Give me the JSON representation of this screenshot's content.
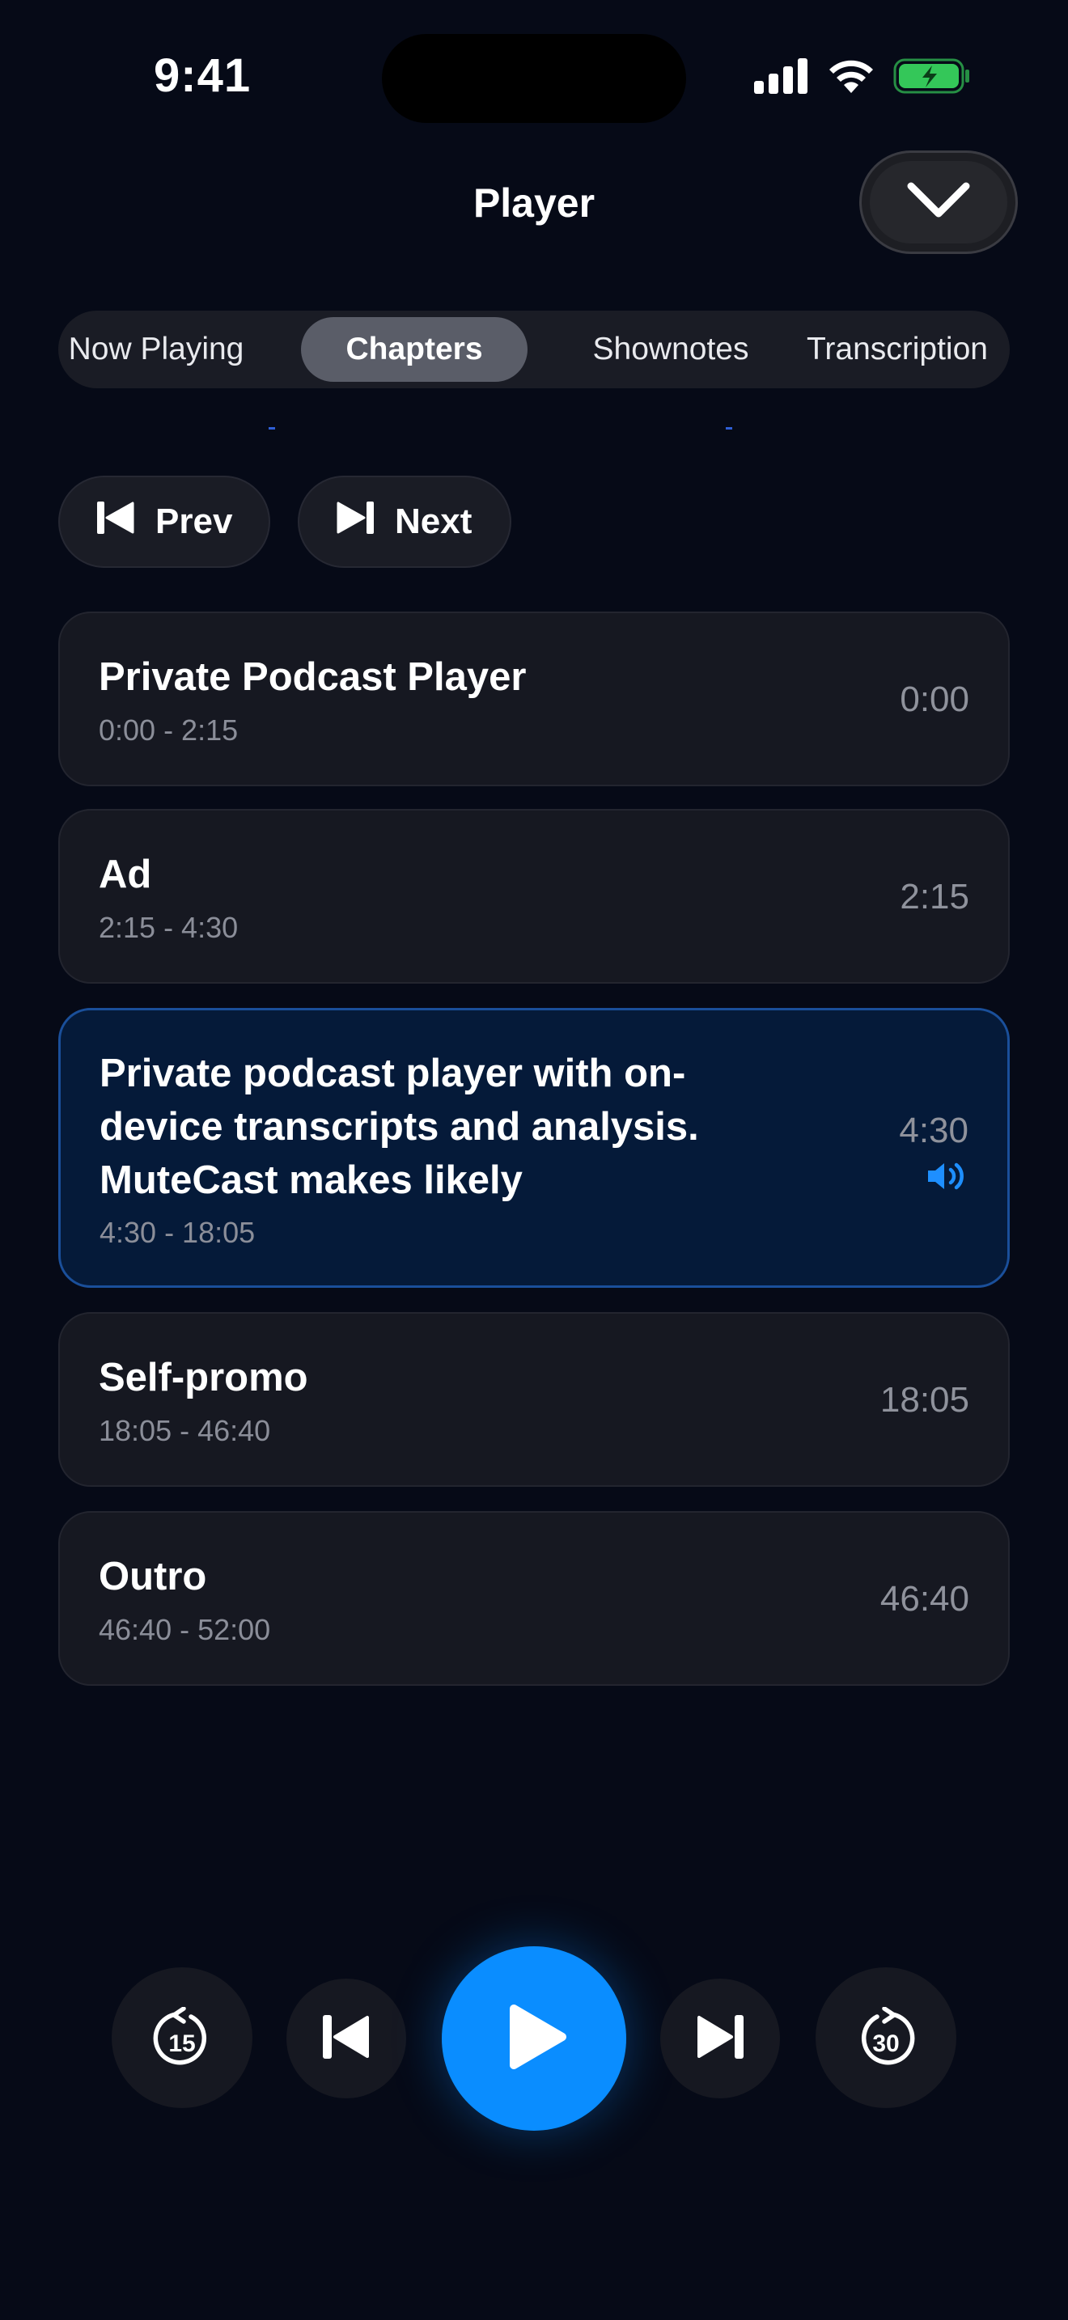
{
  "status_bar": {
    "time": "9:41"
  },
  "header": {
    "title": "Player"
  },
  "tabs": [
    {
      "label": "Now Playing",
      "active": false
    },
    {
      "label": "Chapters",
      "active": true
    },
    {
      "label": "Shownotes",
      "active": false
    },
    {
      "label": "Transcription",
      "active": false
    }
  ],
  "chapter_nav": {
    "prev_label": "Prev",
    "next_label": "Next"
  },
  "chapters": [
    {
      "title": "Private Podcast Player",
      "range": "0:00 - 2:15",
      "start": "0:00",
      "playing": false
    },
    {
      "title": "Ad",
      "range": "2:15 - 4:30",
      "start": "2:15",
      "playing": false
    },
    {
      "title": "Private podcast player with on-device transcripts and analysis. MuteCast makes likely",
      "range": "4:30 - 18:05",
      "start": "4:30",
      "playing": true
    },
    {
      "title": "Self-promo",
      "range": "18:05 - 46:40",
      "start": "18:05",
      "playing": false
    },
    {
      "title": "Outro",
      "range": "46:40 - 52:00",
      "start": "46:40",
      "playing": false
    }
  ],
  "controls": {
    "skip_back_seconds": "15",
    "skip_forward_seconds": "30"
  },
  "colors": {
    "background": "#060a17",
    "accent": "#0a8dff",
    "battery": "#34c759",
    "active_card": "#051a39"
  },
  "icons": [
    "signal-icon",
    "wifi-icon",
    "battery-charging-icon",
    "chevron-down-icon",
    "previous-chapter-icon",
    "next-chapter-icon",
    "speaker-icon",
    "skip-back-15-icon",
    "skip-previous-icon",
    "play-icon",
    "skip-next-icon",
    "skip-forward-30-icon"
  ]
}
